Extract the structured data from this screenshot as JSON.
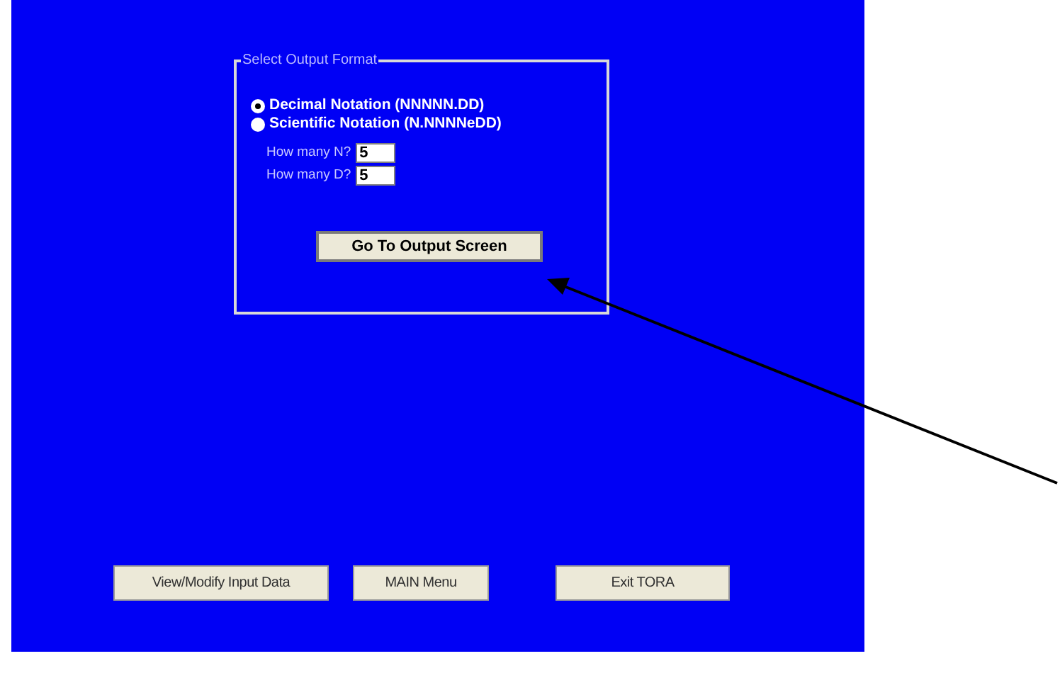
{
  "group": {
    "title": "Select Output Format",
    "options": [
      {
        "label": "Decimal Notation (NNNNN.DD)",
        "selected": true
      },
      {
        "label": "Scientific Notation (N.NNNNeDD)",
        "selected": false
      }
    ],
    "fields": [
      {
        "label": "How many N?",
        "value": "5"
      },
      {
        "label": "How many D?",
        "value": "5"
      }
    ],
    "button": "Go To Output Screen"
  },
  "buttons": [
    "View/Modify Input Data",
    "MAIN Menu",
    "Exit TORA"
  ]
}
